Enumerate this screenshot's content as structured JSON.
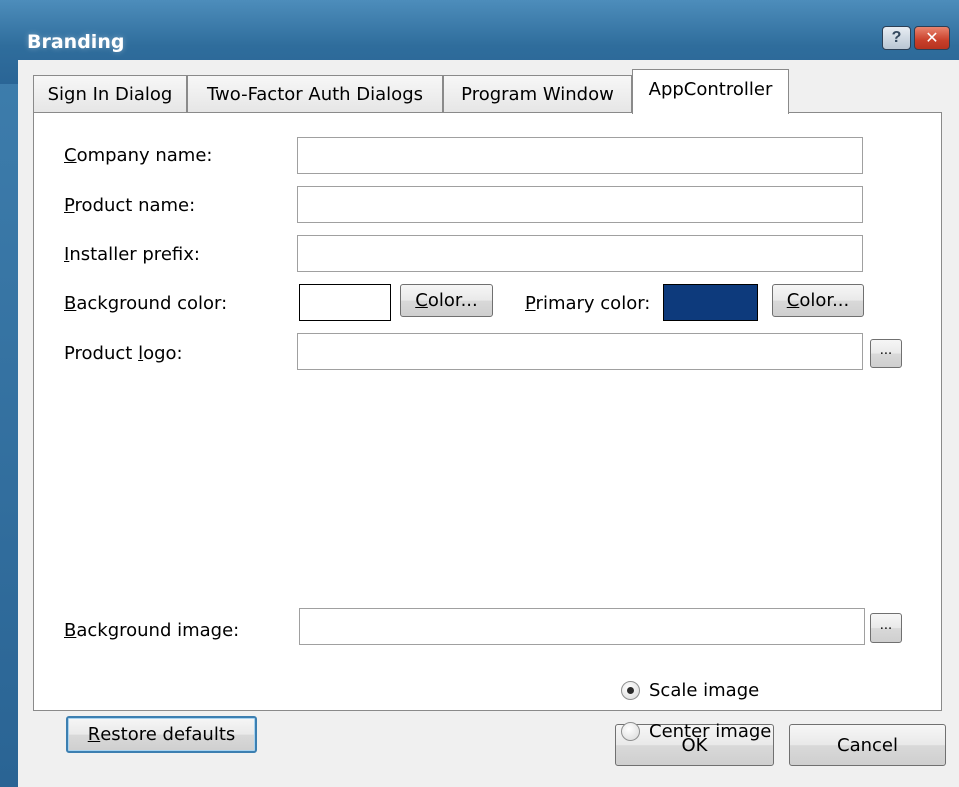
{
  "window": {
    "title": "Branding",
    "help_symbol": "?",
    "close_symbol": "✕"
  },
  "tabs": [
    {
      "label": "Sign In Dialog",
      "active": false
    },
    {
      "label": "Two-Factor Auth Dialogs",
      "active": false
    },
    {
      "label": "Program Window",
      "active": false
    },
    {
      "label": "AppController",
      "active": true
    }
  ],
  "form": {
    "company_name": {
      "label_first": "C",
      "label_rest": "ompany name:",
      "value": ""
    },
    "product_name": {
      "label_first": "P",
      "label_rest": "roduct name:",
      "value": ""
    },
    "installer_prefix": {
      "label_first": "I",
      "label_rest": "nstaller prefix:",
      "value": ""
    },
    "background_color": {
      "label_first": "B",
      "label_rest": "ackground color:",
      "swatch": "#ffffff",
      "button_first": "C",
      "button_rest": "olor..."
    },
    "primary_color": {
      "label_first": "P",
      "label_rest": "rimary color:",
      "swatch": "#0d3a7c",
      "button_first": "C",
      "button_rest": "olor..."
    },
    "product_logo": {
      "label_pre": "Product ",
      "label_under": "l",
      "label_post": "ogo:",
      "value": "",
      "browse": "..."
    },
    "background_image": {
      "label_first": "B",
      "label_rest": "ackground image:",
      "value": "",
      "browse": "..."
    }
  },
  "image_mode": {
    "options": [
      {
        "label": "Scale image",
        "checked": true
      },
      {
        "label": "Center image",
        "checked": false
      }
    ]
  },
  "restore": {
    "label_first": "R",
    "label_rest": "estore defaults"
  },
  "footer": {
    "ok": "OK",
    "cancel": "Cancel"
  },
  "colors": {
    "titlebar": "#2f6d9c",
    "primary_swatch": "#0d3a7c"
  }
}
